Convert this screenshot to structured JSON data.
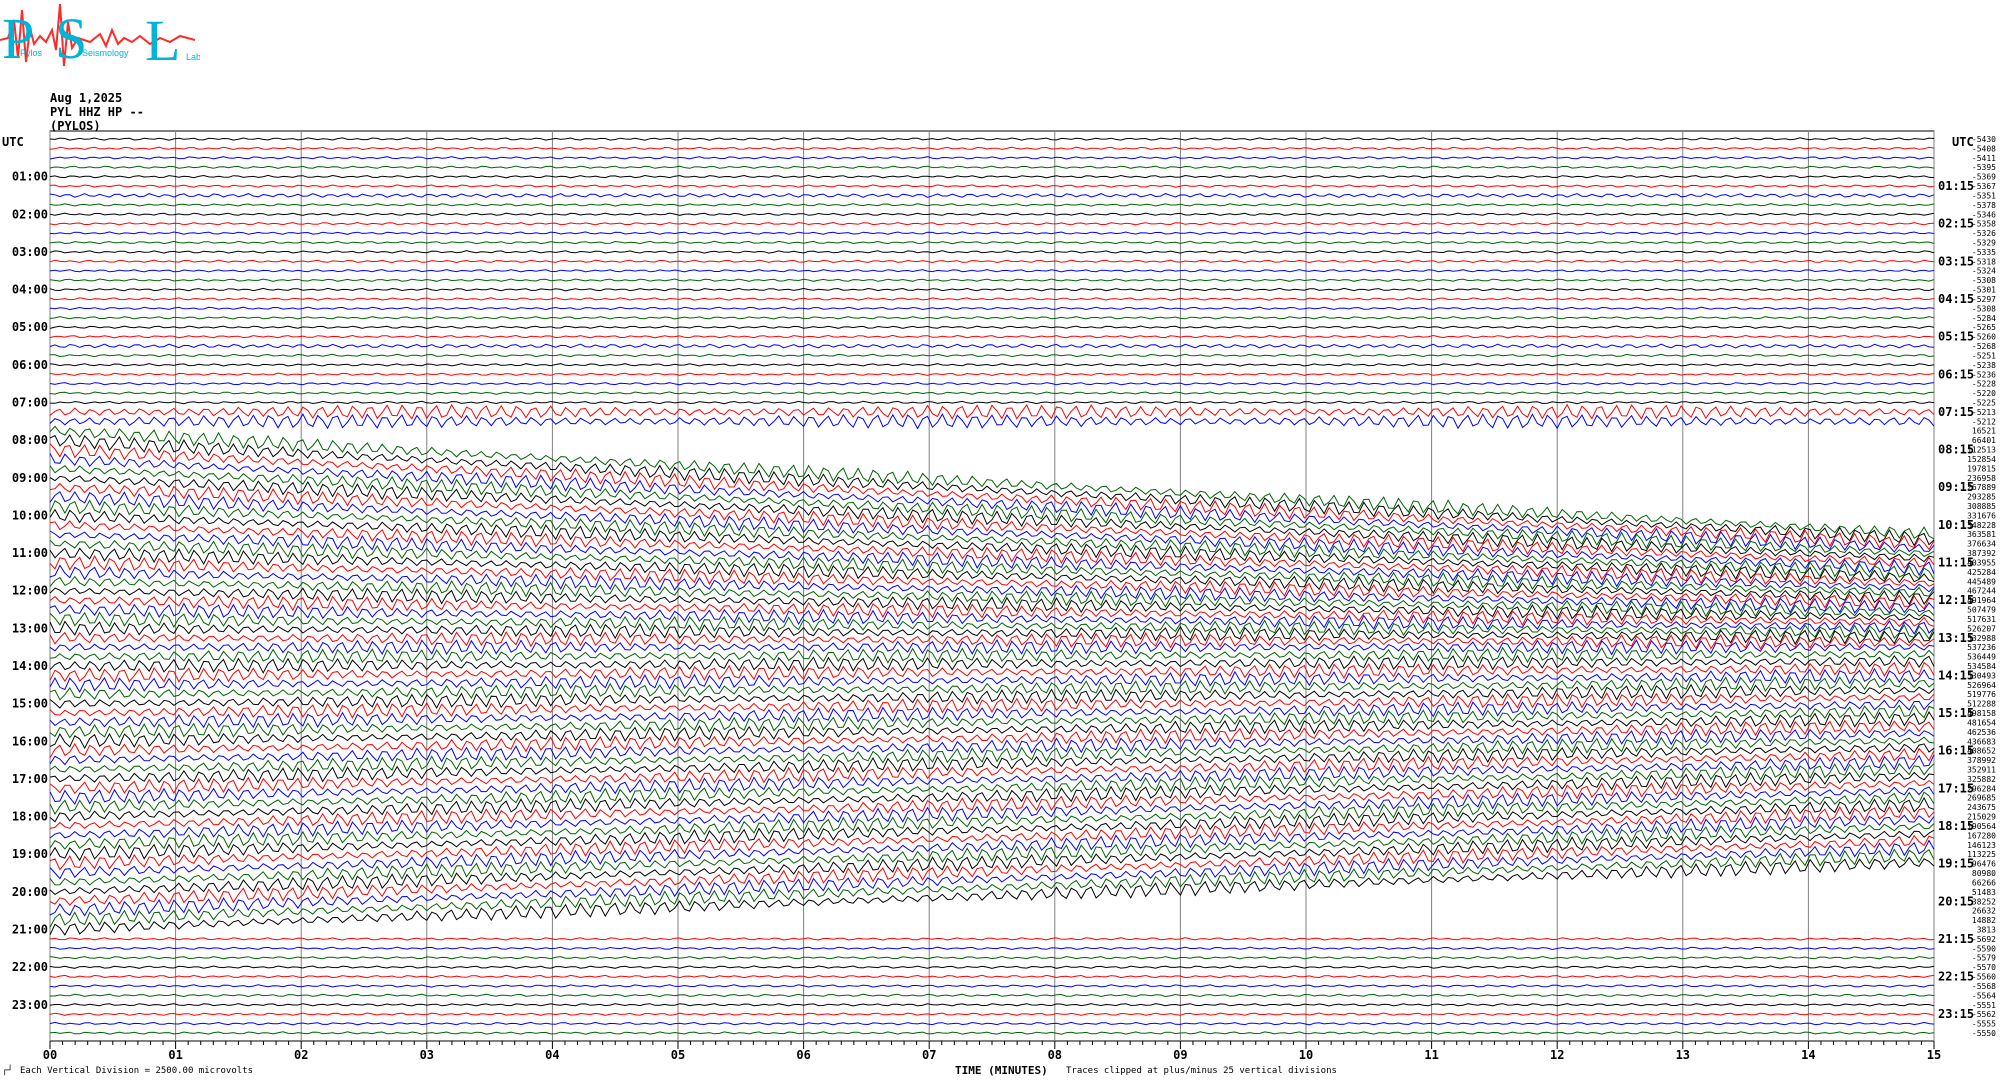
{
  "logo": {
    "letters": [
      "P",
      "S",
      "L"
    ],
    "words": [
      "Pylos",
      "Seismology",
      "Lab"
    ],
    "color": "#00b4d8",
    "wave_color": "#ff2a2a"
  },
  "header": {
    "date": "Aug 1,2025",
    "channel": "PYL HHZ HP --",
    "station": "(PYLOS)"
  },
  "footer": {
    "scale": "Each Vertical Division = 2500.00 microvolts",
    "xlabel": "TIME (MINUTES)",
    "clip_note": "Traces clipped at plus/minus 25 vertical divisions"
  },
  "colors": {
    "series": [
      "#000000",
      "#ff0000",
      "#0000ff",
      "#006400"
    ],
    "grid": "#808080"
  },
  "chart_data": {
    "type": "line",
    "title": "Aug 1,2025 PYL HHZ HP -- (PYLOS)",
    "xlabel": "TIME (MINUTES)",
    "x_ticks": [
      "00",
      "01",
      "02",
      "03",
      "04",
      "05",
      "06",
      "07",
      "08",
      "09",
      "10",
      "11",
      "12",
      "13",
      "14",
      "15"
    ],
    "xlim": [
      0,
      15
    ],
    "traces_per_hour": 4,
    "left_axis_label": "UTC",
    "right_axis_label": "UTC",
    "left_hour_labels": [
      "01:00",
      "02:00",
      "03:00",
      "04:00",
      "05:00",
      "06:00",
      "07:00",
      "08:00",
      "09:00",
      "10:00",
      "11:00",
      "12:00",
      "13:00",
      "14:00",
      "15:00",
      "16:00",
      "17:00",
      "18:00",
      "19:00",
      "20:00",
      "21:00",
      "22:00",
      "23:00"
    ],
    "right_hour_labels": [
      "01:15",
      "02:15",
      "03:15",
      "04:15",
      "05:15",
      "06:15",
      "07:15",
      "08:15",
      "09:15",
      "10:15",
      "11:15",
      "12:15",
      "13:15",
      "14:15",
      "15:15",
      "16:15",
      "17:15",
      "18:15",
      "19:15",
      "20:15",
      "21:15",
      "22:15",
      "23:15"
    ],
    "trace_offsets": [
      -5430,
      -5408,
      -5411,
      -5395,
      -5369,
      -5367,
      -5351,
      -5378,
      -5346,
      -5358,
      -5326,
      -5329,
      -5335,
      -5318,
      -5324,
      -5308,
      -5301,
      -5297,
      -5308,
      -5284,
      -5265,
      -5260,
      -5268,
      -5251,
      -5238,
      -5236,
      -5228,
      -5220,
      -5225,
      -5213,
      -5212,
      16521,
      66401,
      112513,
      152854,
      197815,
      236958,
      267889,
      293285,
      308885,
      331676,
      348228,
      363581,
      376634,
      387392,
      403955,
      425284,
      445489,
      467244,
      491964,
      507479,
      517631,
      526207,
      532988,
      537236,
      536449,
      534584,
      530493,
      526964,
      519776,
      512288,
      498158,
      481654,
      462536,
      436683,
      408652,
      378992,
      352911,
      325882,
      296284,
      269685,
      243675,
      215029,
      190564,
      167280,
      146123,
      113225,
      96476,
      80980,
      66266,
      51483,
      38252,
      26632,
      14882,
      3813,
      -5692,
      -5590,
      -5579,
      -5570,
      -5560,
      -5568,
      -5564,
      -5551,
      -5562,
      -5555,
      -5550
    ]
  }
}
